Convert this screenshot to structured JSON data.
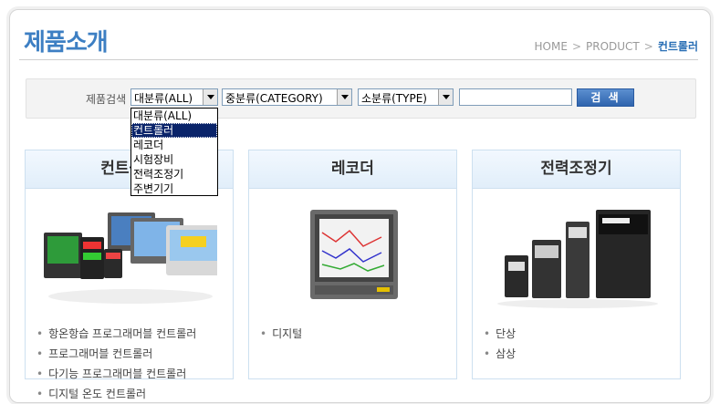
{
  "page": {
    "title": "제품소개"
  },
  "breadcrumb": {
    "home": "HOME",
    "section": "PRODUCT",
    "current": "컨트롤러",
    "separator": ">"
  },
  "search": {
    "label": "제품검색",
    "major": "대분류(ALL)",
    "middle": "중분류(CATEGORY)",
    "minor": "소분류(TYPE)",
    "keyword": "",
    "button": "검 색"
  },
  "dropdown_options": [
    "대분류(ALL)",
    "컨트롤러",
    "레코더",
    "시험장비",
    "전력조정기",
    "주변기기"
  ],
  "dropdown_highlighted": "컨트롤러",
  "cards": [
    {
      "title": "컨트롤러",
      "items": [
        "항온항습 프로그래머블 컨트롤러",
        "프로그래머블 컨트롤러",
        "다기능 프로그래머블 컨트롤러",
        "디지털 온도 컨트롤러"
      ]
    },
    {
      "title": "레코더",
      "items": [
        "디지털"
      ]
    },
    {
      "title": "전력조정기",
      "items": [
        "단상",
        "삼상"
      ]
    }
  ],
  "colors": {
    "accent": "#3d7fc3",
    "card_border": "#cde0f0",
    "highlight": "#0a246a"
  }
}
